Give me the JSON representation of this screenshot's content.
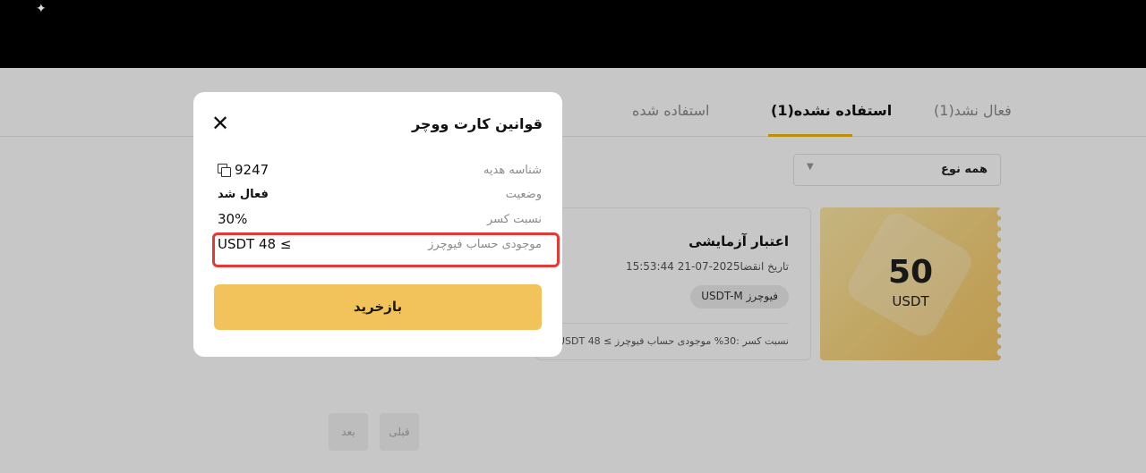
{
  "tabs": {
    "inactive": "فعال نشد(1)",
    "unused": "استفاده نشده(1)",
    "used": "استفاده شده"
  },
  "filter": {
    "label": "همه نوع"
  },
  "voucher": {
    "amount": "50",
    "currency": "USDT",
    "title": "اعتبار آزمایشی",
    "expiry": "تاریخ انقضا2025-07-21 15:53:44",
    "badge": "فیوچرز USDT-M",
    "footer": "نسبت کسر  :30%  موجودی حساب فیوچرز ≥ 48 USDT"
  },
  "pagination": {
    "prev": "قبلی",
    "next": "بعد"
  },
  "modal": {
    "title": "قوانین کارت ووچر",
    "rows": [
      {
        "key": "شناسه هدیه",
        "value": "9247"
      },
      {
        "key": "وضعیت",
        "value": "فعال شد"
      },
      {
        "key": "نسبت کسر",
        "value": "30%"
      },
      {
        "key": "موجودی حساب فیوچرز",
        "value": "USDT 48 ≤"
      }
    ],
    "button": "بازخرید"
  },
  "colors": {
    "accent": "#f0b90b",
    "button": "#f2c35a",
    "highlight": "#e53935"
  }
}
